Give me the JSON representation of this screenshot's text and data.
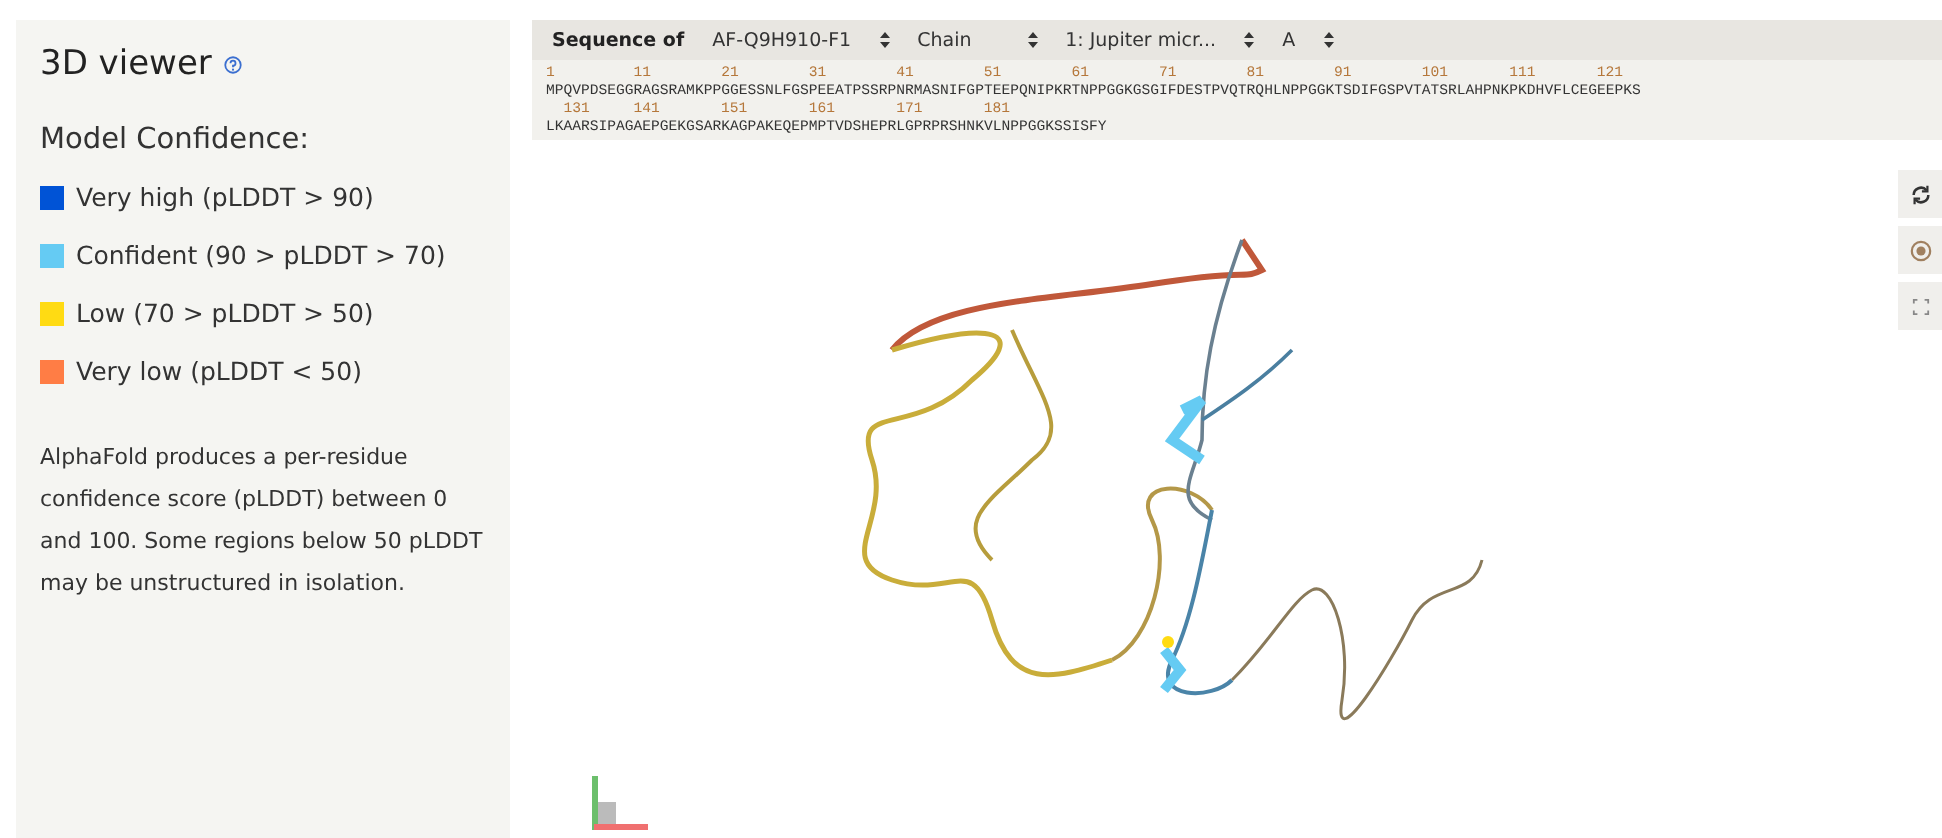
{
  "sidebar": {
    "title": "3D viewer",
    "legend_title": "Model Confidence:",
    "legend": [
      {
        "label": "Very high (pLDDT > 90)",
        "color": "#0053d6"
      },
      {
        "label": "Confident (90 > pLDDT > 70)",
        "color": "#65cbf3"
      },
      {
        "label": "Low (70 > pLDDT > 50)",
        "color": "#ffdb13"
      },
      {
        "label": "Very low (pLDDT < 50)",
        "color": "#ff7d45"
      }
    ],
    "description": "AlphaFold produces a per-residue confidence score (pLDDT) between 0 and 100. Some regions below 50 pLDDT may be unstructured in isolation."
  },
  "sequence": {
    "label": "Sequence of",
    "selects": [
      "AF-Q9H910-F1",
      "Chain",
      "1: Jupiter micr...",
      "A"
    ],
    "lines": [
      {
        "numbers": [
          "1",
          "11",
          "21",
          "31",
          "41",
          "51",
          "61",
          "71",
          "81",
          "91",
          "101",
          "111",
          "121"
        ],
        "residues": "MPQVPDSEGGRAGSRAMKPPGGESSNLFGSPEEATPSSRPNRMASNIFGPTEEPQNIPKRTNPPGGKGSGIFDESTPVQTRQHLNPPGGKTSDIFGSPVTATSRLAHPNKPKDHVFLCEGEEPKS"
      },
      {
        "numbers": [
          "131",
          "141",
          "151",
          "161",
          "171",
          "181"
        ],
        "residues": "LKAARSIPAGAEPGEKGSARKAGPAKEQEPMPTVDSHEPRLGPRPRSHNKVLNPPGGKSSISFY"
      }
    ]
  },
  "viewer": {
    "controls": [
      {
        "kind": "spin"
      },
      {
        "kind": "center"
      },
      {
        "kind": "expand"
      }
    ]
  }
}
